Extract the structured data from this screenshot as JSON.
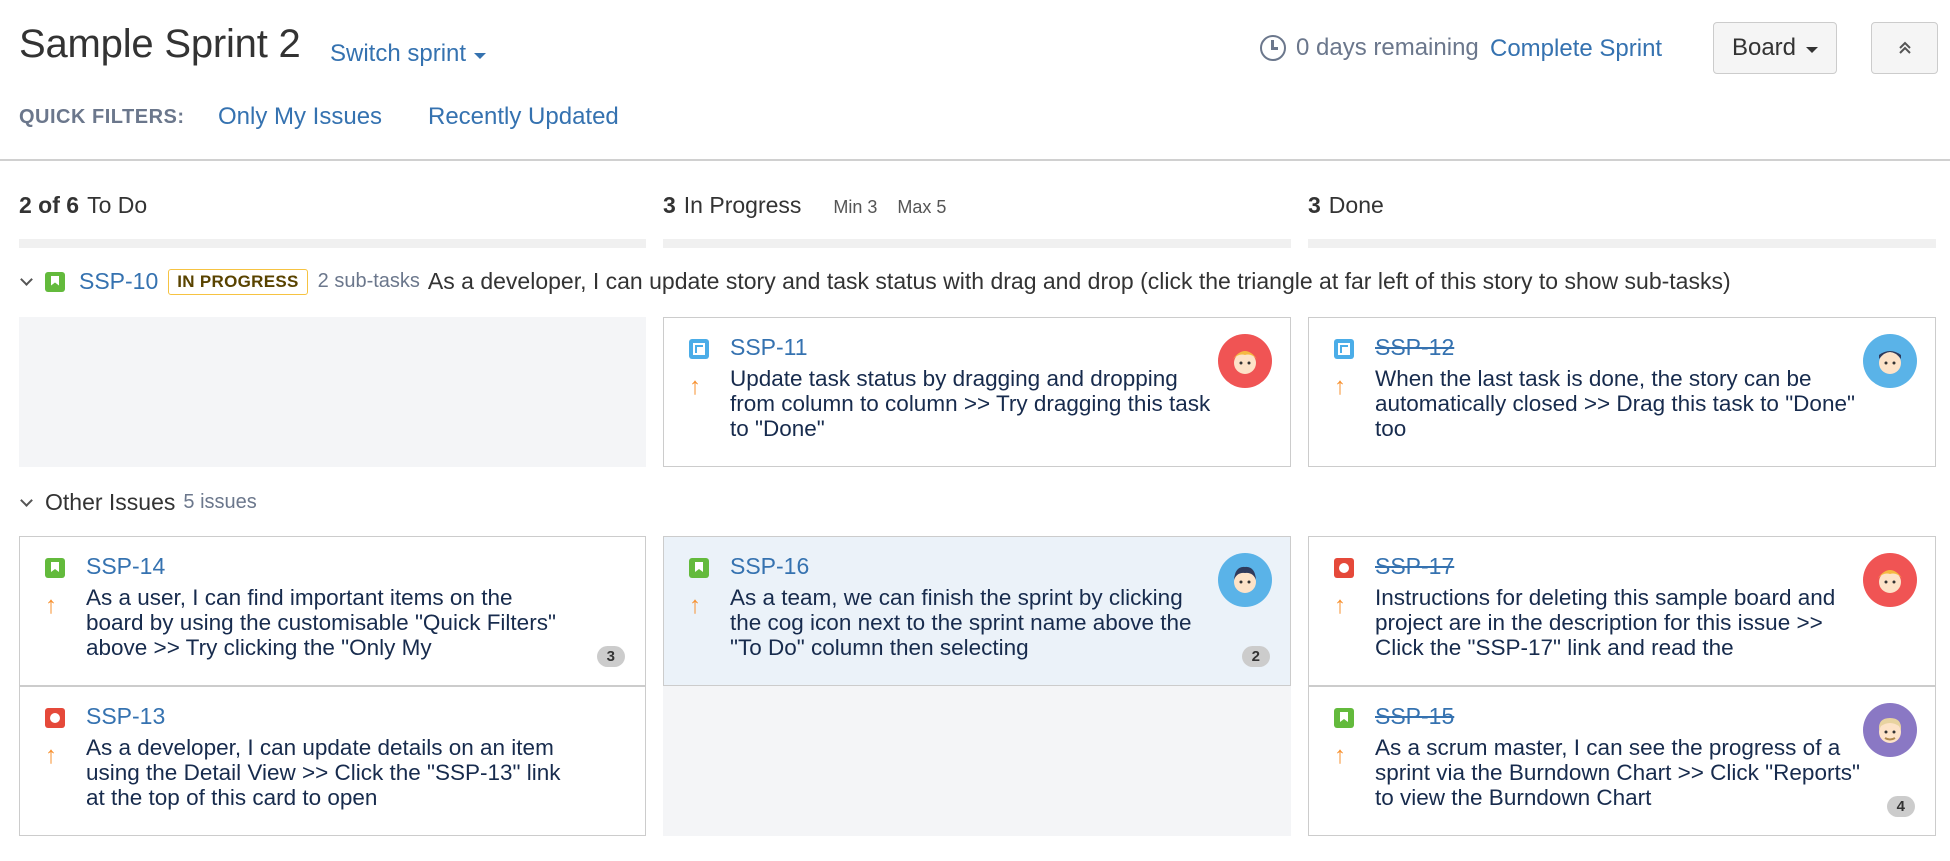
{
  "header": {
    "title": "Sample Sprint 2",
    "switch_sprint": "Switch sprint",
    "days_remaining": "0 days remaining",
    "complete_sprint": "Complete Sprint",
    "board_button": "Board",
    "collapse_icon": "double-chevron-up-icon"
  },
  "quick_filters": {
    "label": "QUICK FILTERS:",
    "items": [
      "Only My Issues",
      "Recently Updated"
    ]
  },
  "columns": [
    {
      "count": "2 of 6",
      "name": "To Do",
      "min": "",
      "max": ""
    },
    {
      "count": "3",
      "name": "In Progress",
      "min": "Min 3",
      "max": "Max 5"
    },
    {
      "count": "3",
      "name": "Done",
      "min": "",
      "max": ""
    }
  ],
  "swimlanes": [
    {
      "key": "SSP-10",
      "status": "IN PROGRESS",
      "subtasks": "2 sub-tasks",
      "summary": "As a developer, I can update story and task status with drag and drop (click the triangle at far left of this story to show sub-tasks)",
      "cards": [
        {
          "key": "SSP-11",
          "type": "task",
          "text": "Update task status by dragging and dropping from column to column >> Try dragging this task to \"Done\"",
          "done": false,
          "avatar": "avatar-red"
        },
        {
          "key": "SSP-12",
          "type": "task",
          "text": "When the last task is done, the story can be automatically closed >> Drag this task to \"Done\" too",
          "done": true,
          "avatar": "avatar-blue"
        }
      ]
    },
    {
      "label": "Other Issues",
      "count": "5 issues",
      "cards": [
        {
          "key": "SSP-14",
          "type": "story",
          "text": "As a user, I can find important items on the board by using the customisable \"Quick Filters\" above >> Try clicking the \"Only My",
          "done": false,
          "badge": "3"
        },
        {
          "key": "SSP-16",
          "type": "story",
          "text": "As a team, we can finish the sprint by clicking the cog icon next to the sprint name above the \"To Do\" column then selecting",
          "done": false,
          "badge": "2",
          "avatar": "avatar-blue"
        },
        {
          "key": "SSP-17",
          "type": "bug",
          "text": "Instructions for deleting this sample board and project are in the description for this issue >> Click the \"SSP-17\" link and read the",
          "done": true,
          "avatar": "avatar-red"
        },
        {
          "key": "SSP-13",
          "type": "bug",
          "text": "As a developer, I can update details on an item using the Detail View >> Click the \"SSP-13\" link at the top of this card to open",
          "done": false
        },
        {
          "key": "SSP-15",
          "type": "story",
          "text": "As a scrum master, I can see the progress of a sprint via the Burndown Chart >> Click \"Reports\" to view the Burndown Chart",
          "done": true,
          "badge": "4",
          "avatar": "avatar-purple"
        }
      ]
    }
  ],
  "colors": {
    "link": "#3572b0",
    "story": "#63ba3c",
    "bug": "#e5493a",
    "task": "#4bade8",
    "priority": "#f79232"
  }
}
